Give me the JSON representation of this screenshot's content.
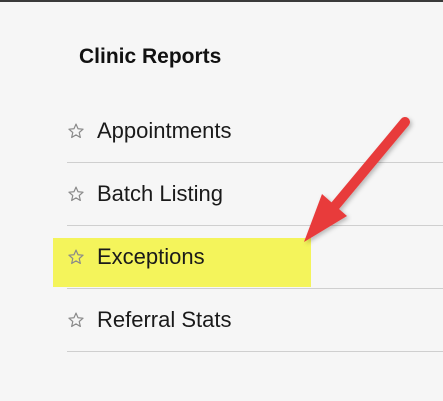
{
  "panel": {
    "title": "Clinic Reports",
    "items": [
      {
        "label": "Appointments",
        "icon": "star-outline-icon"
      },
      {
        "label": "Batch Listing",
        "icon": "star-outline-icon"
      },
      {
        "label": "Exceptions",
        "icon": "star-outline-icon"
      },
      {
        "label": "Referral Stats",
        "icon": "star-outline-icon"
      }
    ]
  },
  "colors": {
    "highlight": "#f4f45b",
    "arrow": "#e83b3b",
    "divider": "#cfcfcf",
    "background": "#f6f6f6"
  }
}
